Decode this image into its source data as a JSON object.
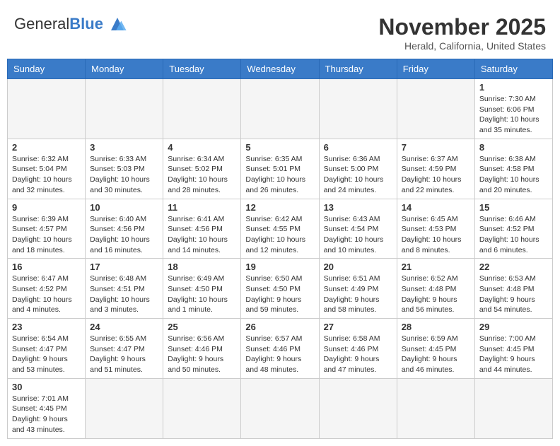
{
  "header": {
    "logo_general": "General",
    "logo_blue": "Blue",
    "month_title": "November 2025",
    "location": "Herald, California, United States"
  },
  "days_of_week": [
    "Sunday",
    "Monday",
    "Tuesday",
    "Wednesday",
    "Thursday",
    "Friday",
    "Saturday"
  ],
  "weeks": [
    [
      {
        "day": "",
        "info": ""
      },
      {
        "day": "",
        "info": ""
      },
      {
        "day": "",
        "info": ""
      },
      {
        "day": "",
        "info": ""
      },
      {
        "day": "",
        "info": ""
      },
      {
        "day": "",
        "info": ""
      },
      {
        "day": "1",
        "info": "Sunrise: 7:30 AM\nSunset: 6:06 PM\nDaylight: 10 hours and 35 minutes."
      }
    ],
    [
      {
        "day": "2",
        "info": "Sunrise: 6:32 AM\nSunset: 5:04 PM\nDaylight: 10 hours and 32 minutes."
      },
      {
        "day": "3",
        "info": "Sunrise: 6:33 AM\nSunset: 5:03 PM\nDaylight: 10 hours and 30 minutes."
      },
      {
        "day": "4",
        "info": "Sunrise: 6:34 AM\nSunset: 5:02 PM\nDaylight: 10 hours and 28 minutes."
      },
      {
        "day": "5",
        "info": "Sunrise: 6:35 AM\nSunset: 5:01 PM\nDaylight: 10 hours and 26 minutes."
      },
      {
        "day": "6",
        "info": "Sunrise: 6:36 AM\nSunset: 5:00 PM\nDaylight: 10 hours and 24 minutes."
      },
      {
        "day": "7",
        "info": "Sunrise: 6:37 AM\nSunset: 4:59 PM\nDaylight: 10 hours and 22 minutes."
      },
      {
        "day": "8",
        "info": "Sunrise: 6:38 AM\nSunset: 4:58 PM\nDaylight: 10 hours and 20 minutes."
      }
    ],
    [
      {
        "day": "9",
        "info": "Sunrise: 6:39 AM\nSunset: 4:57 PM\nDaylight: 10 hours and 18 minutes."
      },
      {
        "day": "10",
        "info": "Sunrise: 6:40 AM\nSunset: 4:56 PM\nDaylight: 10 hours and 16 minutes."
      },
      {
        "day": "11",
        "info": "Sunrise: 6:41 AM\nSunset: 4:56 PM\nDaylight: 10 hours and 14 minutes."
      },
      {
        "day": "12",
        "info": "Sunrise: 6:42 AM\nSunset: 4:55 PM\nDaylight: 10 hours and 12 minutes."
      },
      {
        "day": "13",
        "info": "Sunrise: 6:43 AM\nSunset: 4:54 PM\nDaylight: 10 hours and 10 minutes."
      },
      {
        "day": "14",
        "info": "Sunrise: 6:45 AM\nSunset: 4:53 PM\nDaylight: 10 hours and 8 minutes."
      },
      {
        "day": "15",
        "info": "Sunrise: 6:46 AM\nSunset: 4:52 PM\nDaylight: 10 hours and 6 minutes."
      }
    ],
    [
      {
        "day": "16",
        "info": "Sunrise: 6:47 AM\nSunset: 4:52 PM\nDaylight: 10 hours and 4 minutes."
      },
      {
        "day": "17",
        "info": "Sunrise: 6:48 AM\nSunset: 4:51 PM\nDaylight: 10 hours and 3 minutes."
      },
      {
        "day": "18",
        "info": "Sunrise: 6:49 AM\nSunset: 4:50 PM\nDaylight: 10 hours and 1 minute."
      },
      {
        "day": "19",
        "info": "Sunrise: 6:50 AM\nSunset: 4:50 PM\nDaylight: 9 hours and 59 minutes."
      },
      {
        "day": "20",
        "info": "Sunrise: 6:51 AM\nSunset: 4:49 PM\nDaylight: 9 hours and 58 minutes."
      },
      {
        "day": "21",
        "info": "Sunrise: 6:52 AM\nSunset: 4:48 PM\nDaylight: 9 hours and 56 minutes."
      },
      {
        "day": "22",
        "info": "Sunrise: 6:53 AM\nSunset: 4:48 PM\nDaylight: 9 hours and 54 minutes."
      }
    ],
    [
      {
        "day": "23",
        "info": "Sunrise: 6:54 AM\nSunset: 4:47 PM\nDaylight: 9 hours and 53 minutes."
      },
      {
        "day": "24",
        "info": "Sunrise: 6:55 AM\nSunset: 4:47 PM\nDaylight: 9 hours and 51 minutes."
      },
      {
        "day": "25",
        "info": "Sunrise: 6:56 AM\nSunset: 4:46 PM\nDaylight: 9 hours and 50 minutes."
      },
      {
        "day": "26",
        "info": "Sunrise: 6:57 AM\nSunset: 4:46 PM\nDaylight: 9 hours and 48 minutes."
      },
      {
        "day": "27",
        "info": "Sunrise: 6:58 AM\nSunset: 4:46 PM\nDaylight: 9 hours and 47 minutes."
      },
      {
        "day": "28",
        "info": "Sunrise: 6:59 AM\nSunset: 4:45 PM\nDaylight: 9 hours and 46 minutes."
      },
      {
        "day": "29",
        "info": "Sunrise: 7:00 AM\nSunset: 4:45 PM\nDaylight: 9 hours and 44 minutes."
      }
    ],
    [
      {
        "day": "30",
        "info": "Sunrise: 7:01 AM\nSunset: 4:45 PM\nDaylight: 9 hours and 43 minutes."
      },
      {
        "day": "",
        "info": ""
      },
      {
        "day": "",
        "info": ""
      },
      {
        "day": "",
        "info": ""
      },
      {
        "day": "",
        "info": ""
      },
      {
        "day": "",
        "info": ""
      },
      {
        "day": "",
        "info": ""
      }
    ]
  ]
}
